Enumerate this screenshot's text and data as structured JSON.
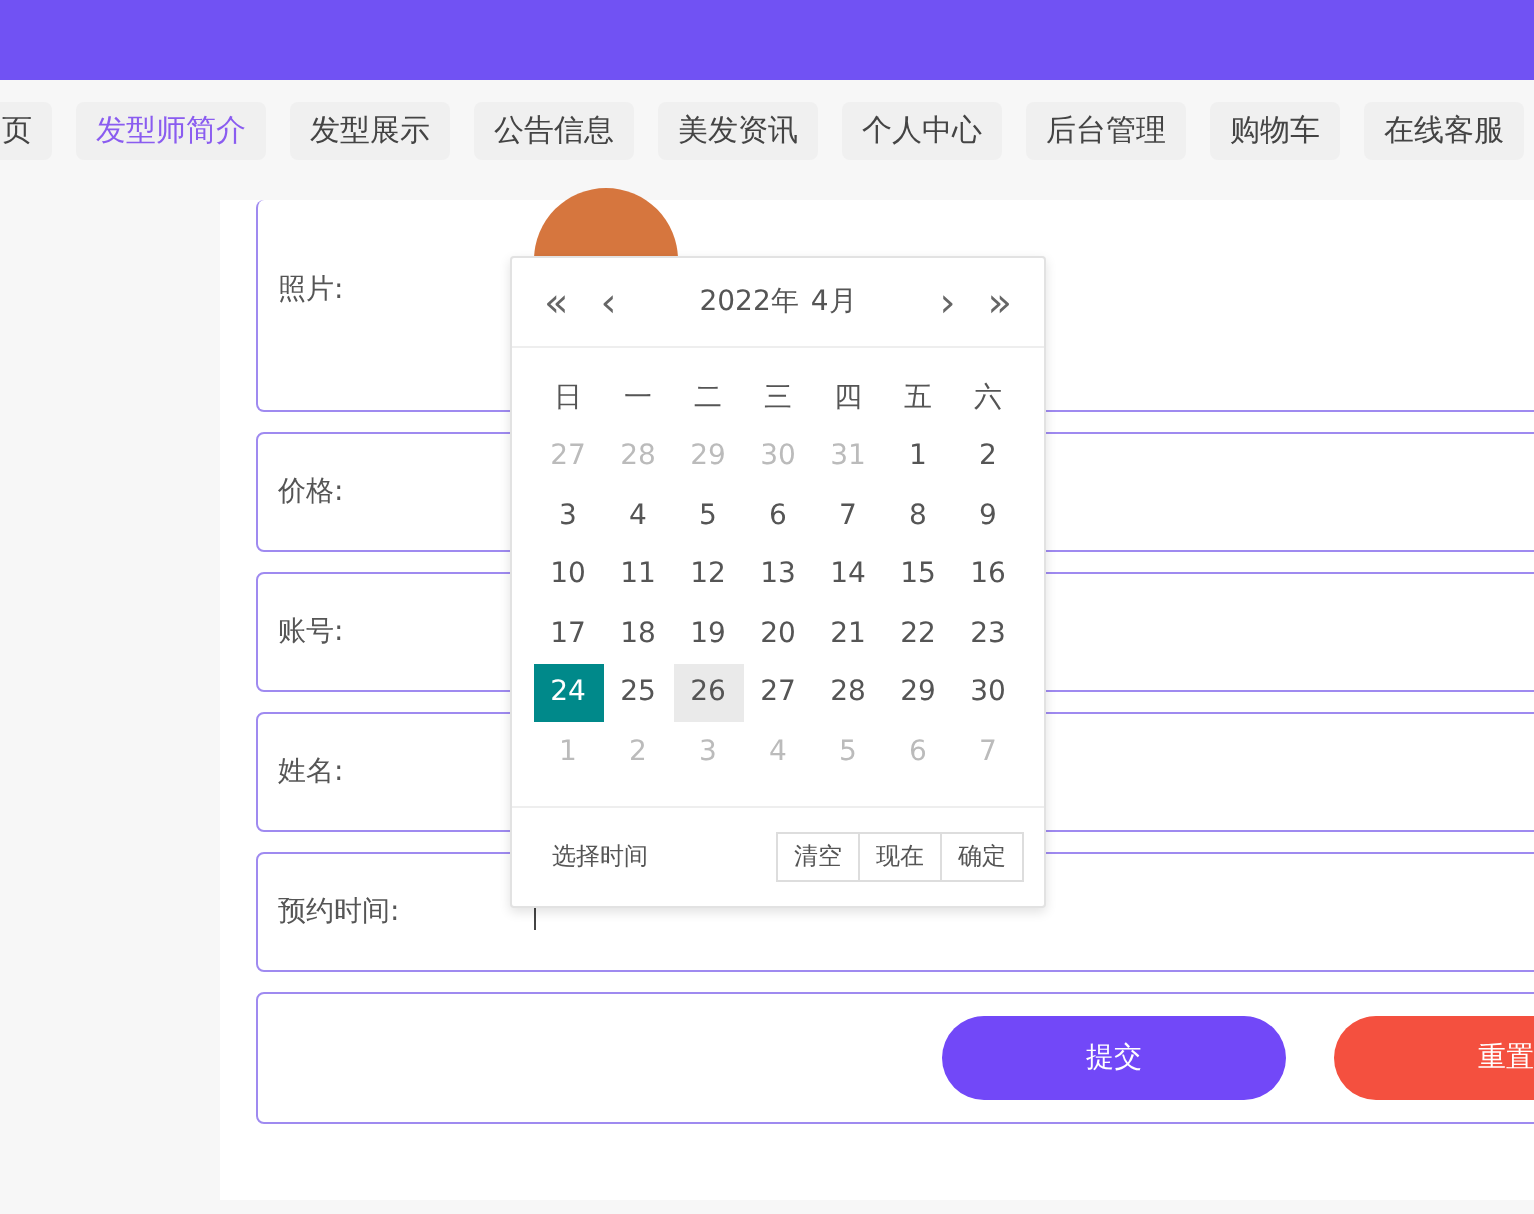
{
  "nav": {
    "tabs": [
      {
        "label": "页",
        "selected": false
      },
      {
        "label": "发型师简介",
        "selected": true
      },
      {
        "label": "发型展示",
        "selected": false
      },
      {
        "label": "公告信息",
        "selected": false
      },
      {
        "label": "美发资讯",
        "selected": false
      },
      {
        "label": "个人中心",
        "selected": false
      },
      {
        "label": "后台管理",
        "selected": false
      },
      {
        "label": "购物车",
        "selected": false
      },
      {
        "label": "在线客服",
        "selected": false
      }
    ]
  },
  "form": {
    "fields": [
      {
        "kind": "photo",
        "label": "照片:"
      },
      {
        "kind": "text",
        "label": "价格:"
      },
      {
        "kind": "text",
        "label": "账号:"
      },
      {
        "kind": "text",
        "label": "姓名:"
      },
      {
        "kind": "date",
        "label": "预约时间:"
      }
    ],
    "buttons": [
      {
        "kind": "primary",
        "label": "提交"
      },
      {
        "kind": "danger",
        "label": "重置"
      }
    ]
  },
  "date_picker": {
    "prev_year": "«",
    "prev_month": "‹",
    "year": "2022年",
    "month": "4月",
    "next_month": "›",
    "next_year": "»",
    "weekdays": [
      "日",
      "一",
      "二",
      "三",
      "四",
      "五",
      "六"
    ],
    "weeks": [
      [
        {
          "day": "27",
          "other_month": true,
          "selected": false,
          "hover": false
        },
        {
          "day": "28",
          "other_month": true,
          "selected": false,
          "hover": false
        },
        {
          "day": "29",
          "other_month": true,
          "selected": false,
          "hover": false
        },
        {
          "day": "30",
          "other_month": true,
          "selected": false,
          "hover": false
        },
        {
          "day": "31",
          "other_month": true,
          "selected": false,
          "hover": false
        },
        {
          "day": "1",
          "other_month": false,
          "selected": false,
          "hover": false
        },
        {
          "day": "2",
          "other_month": false,
          "selected": false,
          "hover": false
        }
      ],
      [
        {
          "day": "3",
          "other_month": false,
          "selected": false,
          "hover": false
        },
        {
          "day": "4",
          "other_month": false,
          "selected": false,
          "hover": false
        },
        {
          "day": "5",
          "other_month": false,
          "selected": false,
          "hover": false
        },
        {
          "day": "6",
          "other_month": false,
          "selected": false,
          "hover": false
        },
        {
          "day": "7",
          "other_month": false,
          "selected": false,
          "hover": false
        },
        {
          "day": "8",
          "other_month": false,
          "selected": false,
          "hover": false
        },
        {
          "day": "9",
          "other_month": false,
          "selected": false,
          "hover": false
        }
      ],
      [
        {
          "day": "10",
          "other_month": false,
          "selected": false,
          "hover": false
        },
        {
          "day": "11",
          "other_month": false,
          "selected": false,
          "hover": false
        },
        {
          "day": "12",
          "other_month": false,
          "selected": false,
          "hover": false
        },
        {
          "day": "13",
          "other_month": false,
          "selected": false,
          "hover": false
        },
        {
          "day": "14",
          "other_month": false,
          "selected": false,
          "hover": false
        },
        {
          "day": "15",
          "other_month": false,
          "selected": false,
          "hover": false
        },
        {
          "day": "16",
          "other_month": false,
          "selected": false,
          "hover": false
        }
      ],
      [
        {
          "day": "17",
          "other_month": false,
          "selected": false,
          "hover": false
        },
        {
          "day": "18",
          "other_month": false,
          "selected": false,
          "hover": false
        },
        {
          "day": "19",
          "other_month": false,
          "selected": false,
          "hover": false
        },
        {
          "day": "20",
          "other_month": false,
          "selected": false,
          "hover": false
        },
        {
          "day": "21",
          "other_month": false,
          "selected": false,
          "hover": false
        },
        {
          "day": "22",
          "other_month": false,
          "selected": false,
          "hover": false
        },
        {
          "day": "23",
          "other_month": false,
          "selected": false,
          "hover": false
        }
      ],
      [
        {
          "day": "24",
          "other_month": false,
          "selected": true,
          "hover": false
        },
        {
          "day": "25",
          "other_month": false,
          "selected": false,
          "hover": false
        },
        {
          "day": "26",
          "other_month": false,
          "selected": false,
          "hover": true
        },
        {
          "day": "27",
          "other_month": false,
          "selected": false,
          "hover": false
        },
        {
          "day": "28",
          "other_month": false,
          "selected": false,
          "hover": false
        },
        {
          "day": "29",
          "other_month": false,
          "selected": false,
          "hover": false
        },
        {
          "day": "30",
          "other_month": false,
          "selected": false,
          "hover": false
        }
      ],
      [
        {
          "day": "1",
          "other_month": true,
          "selected": false,
          "hover": false
        },
        {
          "day": "2",
          "other_month": true,
          "selected": false,
          "hover": false
        },
        {
          "day": "3",
          "other_month": true,
          "selected": false,
          "hover": false
        },
        {
          "day": "4",
          "other_month": true,
          "selected": false,
          "hover": false
        },
        {
          "day": "5",
          "other_month": true,
          "selected": false,
          "hover": false
        },
        {
          "day": "6",
          "other_month": true,
          "selected": false,
          "hover": false
        },
        {
          "day": "7",
          "other_month": true,
          "selected": false,
          "hover": false
        }
      ]
    ],
    "footer_label": "选择时间",
    "actions": [
      "清空",
      "现在",
      "确定"
    ]
  }
}
